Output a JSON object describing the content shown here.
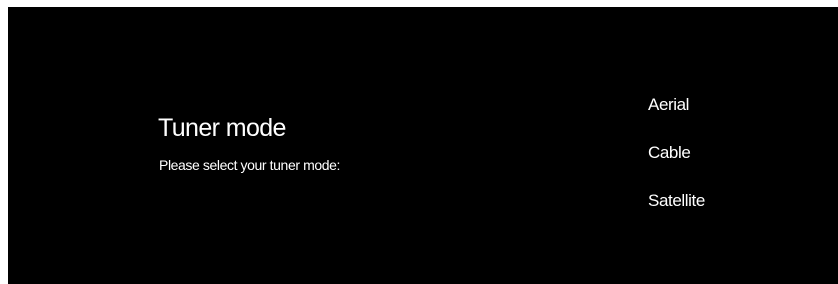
{
  "screen": {
    "background": "#000000",
    "text_color": "#ffffff",
    "title": "Tuner mode",
    "subtitle": "Please select your tuner mode:",
    "options": [
      {
        "label": "Aerial"
      },
      {
        "label": "Cable"
      },
      {
        "label": "Satellite"
      }
    ]
  }
}
